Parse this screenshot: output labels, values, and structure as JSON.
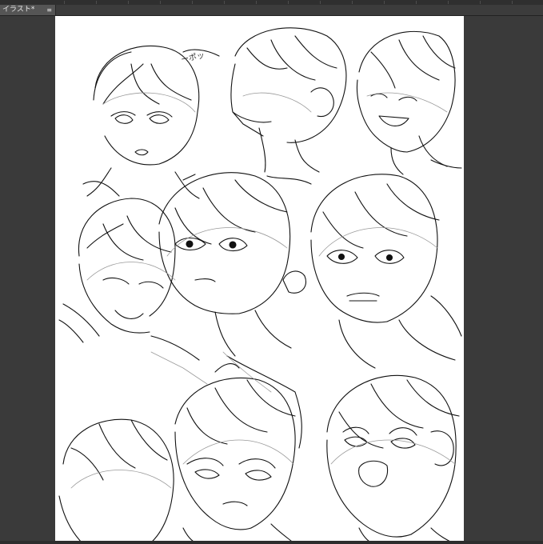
{
  "window": {
    "tab_label": "イラスト*",
    "tab_close": "≡"
  },
  "canvas": {
    "background": "#ffffff",
    "sketch_annotation": "ーポッ"
  },
  "colors": {
    "workspace": "#3a3a3a",
    "tab_active": "#555555",
    "stroke": "#111111",
    "construction": "#9a9a9a"
  }
}
